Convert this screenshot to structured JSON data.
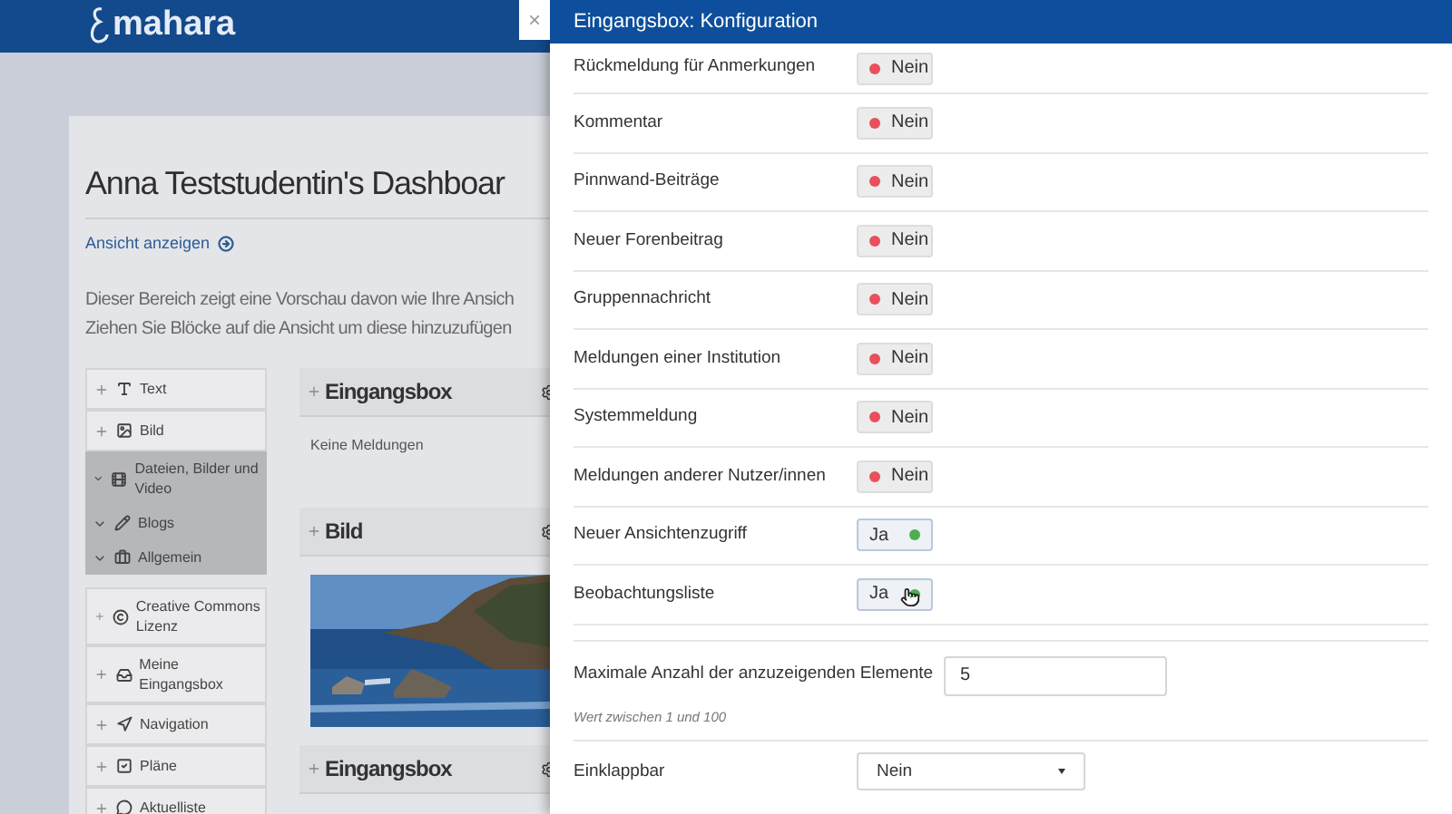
{
  "site": {
    "logo_text": "mahara"
  },
  "dashboard": {
    "title": "Anna Teststudentin's Dashboar",
    "view_link": "Ansicht anzeigen",
    "description": [
      "Dieser Bereich zeigt eine Vorschau davon wie Ihre Ansich",
      "Ziehen Sie Blöcke auf die Ansicht um diese hinzuzufügen"
    ]
  },
  "palette": [
    {
      "label": "Text",
      "kind": "block"
    },
    {
      "label": "Bild",
      "kind": "block"
    },
    {
      "label": "Dateien, Bilder und Video",
      "kind": "category",
      "expanded": false
    },
    {
      "label": "Blogs",
      "kind": "category",
      "expanded": false
    },
    {
      "label": "Allgemein",
      "kind": "category",
      "expanded": false
    },
    {
      "label": "Creative Commons Lizenz",
      "kind": "block"
    },
    {
      "label": "Meine Eingangsbox",
      "kind": "block"
    },
    {
      "label": "Navigation",
      "kind": "block"
    },
    {
      "label": "Pläne",
      "kind": "block"
    },
    {
      "label": "Aktuelliste",
      "kind": "block"
    }
  ],
  "blocks": [
    {
      "title": "Eingangsbox",
      "kind": "text",
      "body": "Keine Meldungen"
    },
    {
      "title": "Bild",
      "kind": "picture"
    },
    {
      "title": "Eingangsbox",
      "kind": "cut"
    }
  ],
  "panel": {
    "close": "×",
    "title": "Eingangsbox: Konfiguration",
    "settings": [
      {
        "kind": "toggle",
        "label": "Rückmeldung für Anmerkungen",
        "value": "Nein",
        "on": false
      },
      {
        "kind": "toggle",
        "label": "Kommentar",
        "value": "Nein",
        "on": false
      },
      {
        "kind": "toggle",
        "label": "Pinnwand-Beiträge",
        "value": "Nein",
        "on": false
      },
      {
        "kind": "toggle",
        "label": "Neuer Forenbeitrag",
        "value": "Nein",
        "on": false
      },
      {
        "kind": "toggle",
        "label": "Gruppennachricht",
        "value": "Nein",
        "on": false
      },
      {
        "kind": "toggle",
        "label": "Meldungen einer Institution",
        "value": "Nein",
        "on": false
      },
      {
        "kind": "toggle",
        "label": "Systemmeldung",
        "value": "Nein",
        "on": false
      },
      {
        "kind": "toggle",
        "label": "Meldungen anderer Nutzer/innen",
        "value": "Nein",
        "on": false
      },
      {
        "kind": "toggle",
        "label": "Neuer Ansichtenzugriff",
        "value": "Ja",
        "on": true
      },
      {
        "kind": "toggle",
        "label": "Beobachtungsliste",
        "value": "Ja",
        "on": true
      },
      {
        "kind": "number",
        "label": "Maximale Anzahl der anzuzeigenden Elemente",
        "value": "5",
        "help": "Wert zwischen 1 und 100"
      },
      {
        "kind": "select",
        "label": "Einklappbar",
        "value": "Nein"
      }
    ]
  }
}
